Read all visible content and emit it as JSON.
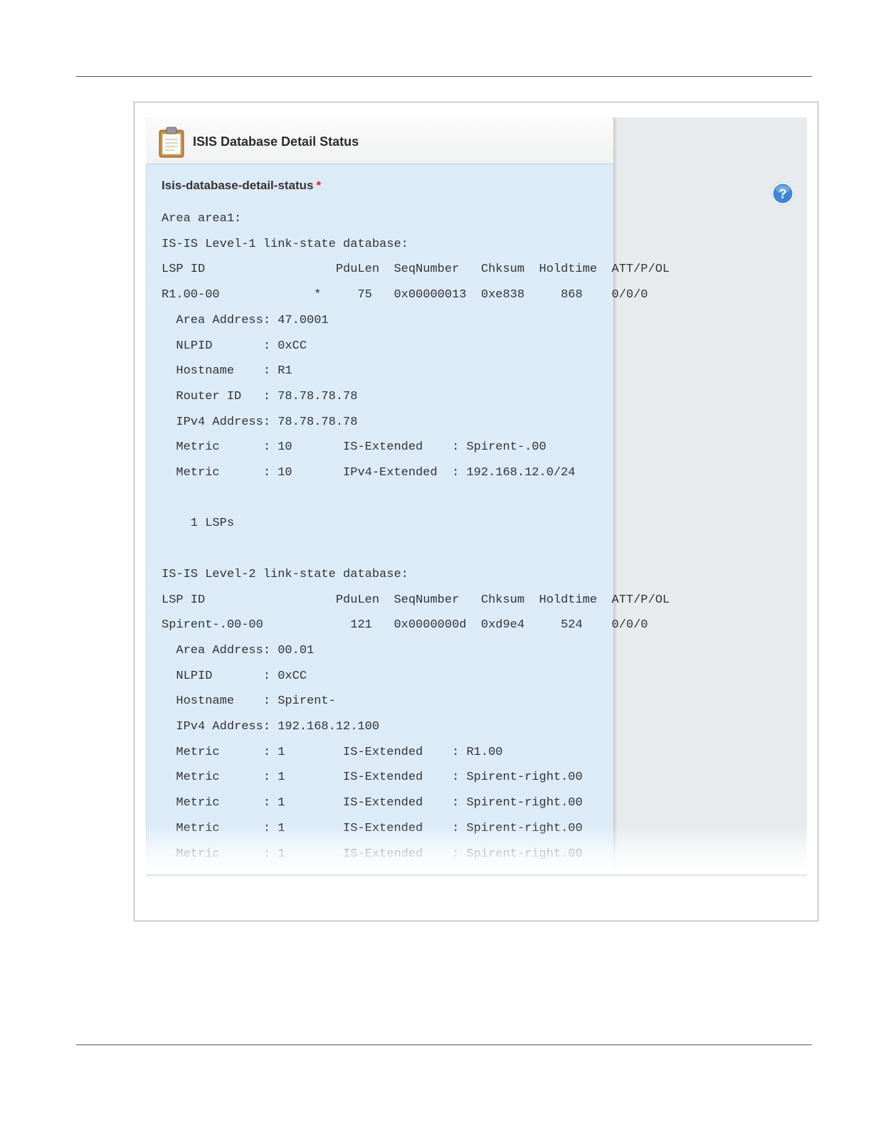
{
  "panel": {
    "title": "ISIS Database Detail Status",
    "icon": "clipboard-icon",
    "section_label": "Isis-database-detail-status",
    "required_mark": "*"
  },
  "help": {
    "icon": "help-icon",
    "glyph": "?"
  },
  "status_lines": [
    "Area area1:",
    "IS-IS Level-1 link-state database:",
    "LSP ID                  PduLen  SeqNumber   Chksum  Holdtime  ATT/P/OL",
    "R1.00-00             *     75   0x00000013  0xe838     868    0/0/0",
    "  Area Address: 47.0001",
    "  NLPID       : 0xCC",
    "  Hostname    : R1",
    "  Router ID   : 78.78.78.78",
    "  IPv4 Address: 78.78.78.78",
    "  Metric      : 10       IS-Extended    : Spirent-.00",
    "  Metric      : 10       IPv4-Extended  : 192.168.12.0/24",
    "",
    "    1 LSPs",
    "",
    "IS-IS Level-2 link-state database:",
    "LSP ID                  PduLen  SeqNumber   Chksum  Holdtime  ATT/P/OL",
    "Spirent-.00-00            121   0x0000000d  0xd9e4     524    0/0/0",
    "  Area Address: 00.01",
    "  NLPID       : 0xCC",
    "  Hostname    : Spirent-",
    "  IPv4 Address: 192.168.12.100",
    "  Metric      : 1        IS-Extended    : R1.00",
    "  Metric      : 1        IS-Extended    : Spirent-right.00",
    "  Metric      : 1        IS-Extended    : Spirent-right.00",
    "  Metric      : 1        IS-Extended    : Spirent-right.00",
    "  Metric      : 1        IS-Extended    : Spirent-right.00"
  ],
  "colors": {
    "panel_body": "#dcebf8",
    "background": "#e7ebee",
    "required": "#e1241b",
    "help_button": "#3d86d6"
  }
}
